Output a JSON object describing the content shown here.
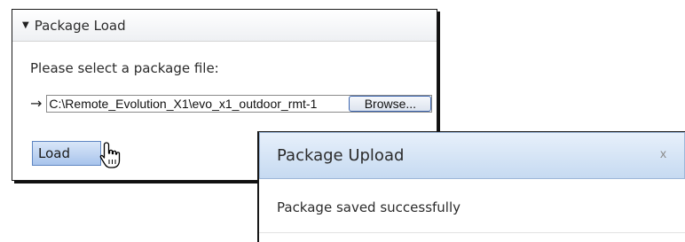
{
  "load_panel": {
    "title": "Package Load",
    "prompt": "Please select a package file:",
    "file_path_value": "C:\\Remote_Evolution_X1\\evo_x1_outdoor_rmt-1",
    "browse_label": "Browse...",
    "load_label": "Load"
  },
  "upload_dialog": {
    "title": "Package Upload",
    "close_label": "x",
    "message": "Package saved successfully"
  },
  "icons": {
    "caret": "triangle-down-icon",
    "arrow": "right-arrow-icon",
    "cursor": "hand-pointer-icon"
  }
}
